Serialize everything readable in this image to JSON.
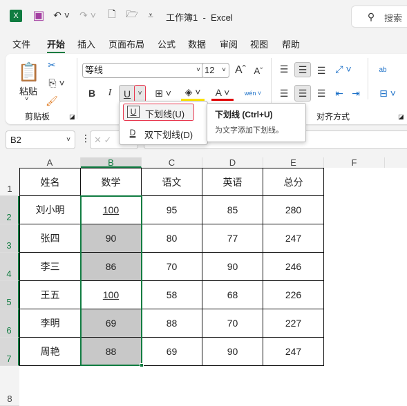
{
  "titlebar": {
    "title": "工作簿1  -  Excel",
    "search": "搜索"
  },
  "tabs": [
    "文件",
    "开始",
    "插入",
    "页面布局",
    "公式",
    "数据",
    "审阅",
    "视图",
    "帮助"
  ],
  "active_tab": "开始",
  "ribbon": {
    "paste": "粘贴",
    "clipboard_group": "剪贴板",
    "font_name": "等线",
    "font_size": "12",
    "bold": "B",
    "italic": "I",
    "underline": "U",
    "alignment_group": "对齐方式",
    "wrap": "ab",
    "phonetic": "wén"
  },
  "underline_menu": {
    "items": [
      {
        "icon": "U",
        "label": "下划线(U)"
      },
      {
        "icon": "D",
        "label": "双下划线(D)"
      }
    ]
  },
  "tooltip": {
    "title": "下划线 (Ctrl+U)",
    "desc": "为文字添加下划线。"
  },
  "formula_bar": {
    "name_box": "B2",
    "value": ""
  },
  "columns": [
    "A",
    "B",
    "C",
    "D",
    "E",
    "F"
  ],
  "rows": [
    "1",
    "2",
    "3",
    "4",
    "5",
    "6",
    "7",
    "8"
  ],
  "table": [
    [
      "姓名",
      "数学",
      "语文",
      "英语",
      "总分"
    ],
    [
      "刘小明",
      "100",
      "95",
      "85",
      "280"
    ],
    [
      "张四",
      "90",
      "80",
      "77",
      "247"
    ],
    [
      "李三",
      "86",
      "70",
      "90",
      "246"
    ],
    [
      "王五",
      "100",
      "58",
      "68",
      "226"
    ],
    [
      "李明",
      "69",
      "88",
      "70",
      "227"
    ],
    [
      "周艳",
      "88",
      "69",
      "90",
      "247"
    ]
  ],
  "underlined_cells": [
    "B2",
    "B5"
  ],
  "colors": {
    "accent": "#107c41",
    "highlight": "#e8384f",
    "cell_fill": "#c8c8c8",
    "font_color": "#e00000",
    "fill_color": "#ffe600"
  }
}
